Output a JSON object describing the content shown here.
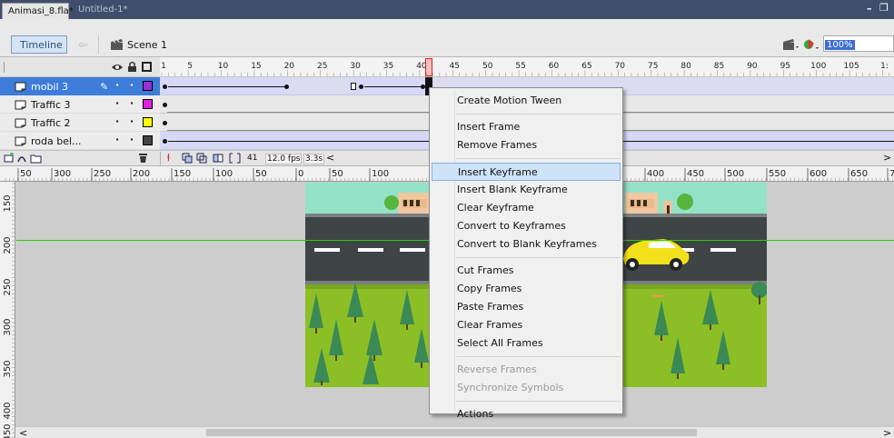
{
  "tabs": [
    {
      "label": "Animasi_8.fla*"
    },
    {
      "label": "Untitled-1*"
    }
  ],
  "window_controls": {
    "minimize": "–",
    "restore": "❐"
  },
  "nav": {
    "timeline_label": "Timeline",
    "scene_label": "Scene 1",
    "zoom": "100%"
  },
  "frame_ruler": {
    "labels": [
      "1",
      "5",
      "10",
      "15",
      "20",
      "25",
      "30",
      "35",
      "40",
      "45",
      "50",
      "55",
      "60",
      "65",
      "70",
      "75",
      "80",
      "85",
      "90",
      "95",
      "100",
      "105",
      "1:"
    ]
  },
  "layers": [
    {
      "name": "mobil 3",
      "color": "#9b30d8",
      "selected": true
    },
    {
      "name": "Traffic 3",
      "color": "#e020e0",
      "selected": false
    },
    {
      "name": "Traffic 2",
      "color": "#ffff00",
      "selected": false
    },
    {
      "name": "roda bel...",
      "color": "#444444",
      "selected": false
    }
  ],
  "status": {
    "frame": "41",
    "fps": "12.0 fps",
    "time": "3.3s"
  },
  "stage_ruler": {
    "labels": [
      "50",
      "300",
      "250",
      "200",
      "150",
      "100",
      "50",
      "0",
      "50",
      "100",
      "400",
      "450",
      "500",
      "550",
      "600",
      "650",
      "7"
    ]
  },
  "vertical_ruler": {
    "labels": [
      "150",
      "200",
      "250",
      "300",
      "350",
      "400",
      "450"
    ]
  },
  "context_menu": {
    "groups": [
      [
        {
          "label": "Create Motion Tween",
          "enabled": true
        }
      ],
      [
        {
          "label": "Insert Frame",
          "enabled": true
        },
        {
          "label": "Remove Frames",
          "enabled": true
        }
      ],
      [
        {
          "label": "Insert Keyframe",
          "enabled": true,
          "highlighted": true
        },
        {
          "label": "Insert Blank Keyframe",
          "enabled": true
        },
        {
          "label": "Clear Keyframe",
          "enabled": true
        },
        {
          "label": "Convert to Keyframes",
          "enabled": true
        },
        {
          "label": "Convert to Blank Keyframes",
          "enabled": true
        }
      ],
      [
        {
          "label": "Cut Frames",
          "enabled": true
        },
        {
          "label": "Copy Frames",
          "enabled": true
        },
        {
          "label": "Paste Frames",
          "enabled": true
        },
        {
          "label": "Clear Frames",
          "enabled": true
        },
        {
          "label": "Select All Frames",
          "enabled": true
        }
      ],
      [
        {
          "label": "Reverse Frames",
          "enabled": false
        },
        {
          "label": "Synchronize Symbols",
          "enabled": false
        }
      ],
      [
        {
          "label": "Actions",
          "enabled": true
        }
      ]
    ]
  },
  "colors": {
    "titlebar": "#3f4f6b",
    "selected_layer": "#3d7cd9",
    "menu_highlight": "#cfe3f8",
    "playhead": "#e02020",
    "guide_line": "#28d000",
    "sky": "#93e2c8",
    "road": "#3f4447",
    "grass": "#8cbf25",
    "tree": "#3b8a55",
    "car": "#f2e01a"
  },
  "icons": {
    "back": "left-arrow-icon",
    "scene": "clapper-icon",
    "edit_symbols": "edit-symbols-icon",
    "edit_scene": "edit-scene-icon",
    "eye": "eye-icon",
    "lock": "lock-icon",
    "outline": "outline-icon",
    "trash": "trash-icon",
    "pencil": "pencil-icon"
  }
}
